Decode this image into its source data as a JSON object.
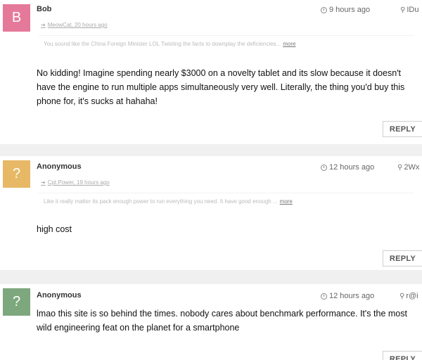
{
  "comments": [
    {
      "avatar_letter": "B",
      "avatar_color": "#e5799a",
      "author": "Bob",
      "time": "9 hours ago",
      "location": "IDu",
      "reply_to": "MeowCat, 20 hours ago",
      "quote": "You sound like the China Foreign Minister LOL Twisting the facts to downplay the deficiencies...",
      "quote_more": "more",
      "body": "No kidding! Imagine spending nearly $3000 on a novelty tablet and its slow because it doesn't have the engine to run multiple apps simultaneously very well. Literally, the thing you'd buy this phone for, it's sucks at hahaha!",
      "reply_label": "REPLY"
    },
    {
      "avatar_letter": "?",
      "avatar_color": "#e7b865",
      "author": "Anonymous",
      "time": "12 hours ago",
      "location": "2Wx",
      "reply_to": "Cpt.Power, 19 hours ago",
      "quote": "Like it really matter its pack enough power to run everything you need. It have good enough ...",
      "quote_more": "more",
      "body": "high cost",
      "reply_label": "REPLY"
    },
    {
      "avatar_letter": "?",
      "avatar_color": "#7da77c",
      "author": "Anonymous",
      "time": "12 hours ago",
      "location": "r@i",
      "body": "lmao this site is so behind the times. nobody cares about benchmark performance. It's the most wild engineering feat on the planet for a smartphone",
      "reply_label": "REPLY"
    }
  ]
}
